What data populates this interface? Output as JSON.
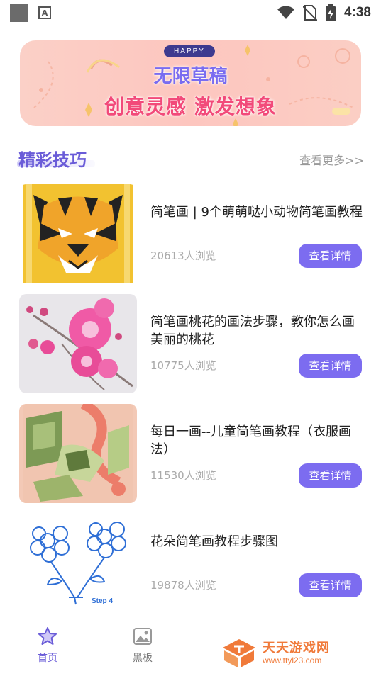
{
  "status_bar": {
    "time": "4:38",
    "left_icons": [
      "app-square-icon",
      "a-letter-icon"
    ],
    "a_letter": "A",
    "right_icons": [
      "wifi-icon",
      "no-sim-icon",
      "battery-charging-icon"
    ]
  },
  "banner": {
    "happy": "HAPPY",
    "title": "无限草稿",
    "subtitle": "创意灵感 激发想象"
  },
  "section": {
    "title": "精彩技巧",
    "more": "查看更多>>"
  },
  "articles": [
    {
      "title": "简笔画 | 9个萌萌哒小动物简笔画教程",
      "views": "20613人浏览",
      "button": "查看详情",
      "thumb": "tiger-drawing"
    },
    {
      "title": "简笔画桃花的画法步骤，教你怎么画美丽的桃花",
      "views": "10775人浏览",
      "button": "查看详情",
      "thumb": "peach-blossom-drawing"
    },
    {
      "title": "每日一画--儿童简笔画教程（衣服画法）",
      "views": "11530人浏览",
      "button": "查看详情",
      "thumb": "clothes-drawing"
    },
    {
      "title": "花朵简笔画教程步骤图",
      "views": "19878人浏览",
      "button": "查看详情",
      "thumb": "flower-drawing",
      "thumb_caption": "Step 4"
    }
  ],
  "bottom_nav": {
    "items": [
      {
        "label": "首页",
        "icon": "star-icon",
        "active": true
      },
      {
        "label": "黑板",
        "icon": "image-icon",
        "active": false
      }
    ],
    "active_color": "#6a5cd8",
    "inactive_color": "#777777"
  },
  "watermark": {
    "text": "天天游戏网",
    "url": "www.ttyl23.com"
  },
  "colors": {
    "accent": "#7c6cf0",
    "banner_bg": "#fdc6bf",
    "title_pink": "#f24a7a"
  }
}
